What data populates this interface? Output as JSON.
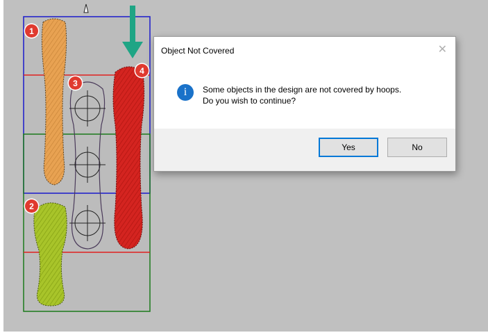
{
  "design": {
    "markers": [
      "1",
      "2",
      "3",
      "4"
    ]
  },
  "dialog": {
    "title": "Object Not Covered",
    "close_label": "✕",
    "icon": "info-icon",
    "icon_glyph": "i",
    "message_line1": "Some objects in the design are not covered by hoops.",
    "message_line2": "Do you wish to continue?",
    "yes_label": "Yes",
    "no_label": "No"
  },
  "colors": {
    "canvas": "#c0c0c0",
    "hoop_blue": "#1a1acc",
    "hoop_red": "#e0201e",
    "hoop_green": "#1b7a1b",
    "orange_object": "#e8a252",
    "green_object": "#a8c42a",
    "red_object": "#d42420",
    "arrow": "#1fa585",
    "accent": "#0078d7"
  }
}
